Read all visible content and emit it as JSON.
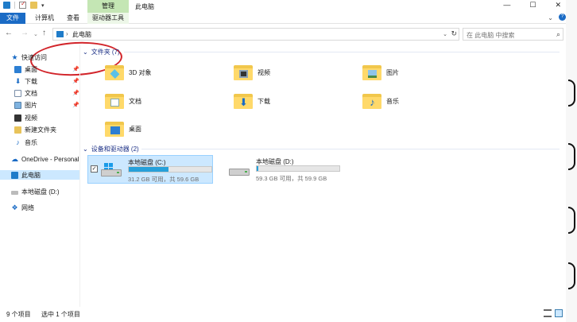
{
  "title_bar": {
    "manage_tab": "管理",
    "window_title": "此电脑",
    "controls": {
      "minimize": "—",
      "maximize": "☐",
      "close": "✕"
    }
  },
  "ribbon": {
    "tabs": [
      {
        "label": "文件",
        "active": true
      },
      {
        "label": "计算机"
      },
      {
        "label": "查看"
      },
      {
        "label": "驱动器工具"
      }
    ],
    "expand_glyph": "⌄",
    "help_glyph": "?"
  },
  "address": {
    "back": "←",
    "forward": "→",
    "recent": "⌄",
    "up": "↑",
    "separator": "›",
    "path": "此电脑",
    "dropdown": "⌄",
    "refresh": "↻",
    "search_placeholder": "在 此电脑 中搜索",
    "search_glyph": "⌕"
  },
  "sidebar": {
    "items": [
      {
        "label": "快速访问",
        "icon": "star-icon",
        "glyph": "★"
      },
      {
        "label": "桌面",
        "icon": "desktop-icon",
        "pinned": true
      },
      {
        "label": "下载",
        "icon": "download-icon",
        "glyph": "⬇",
        "pinned": true
      },
      {
        "label": "文档",
        "icon": "document-icon",
        "pinned": true
      },
      {
        "label": "图片",
        "icon": "picture-icon",
        "pinned": true
      },
      {
        "label": "视频",
        "icon": "video-icon"
      },
      {
        "label": "新建文件夹",
        "icon": "folder-icon"
      },
      {
        "label": "音乐",
        "icon": "music-icon",
        "glyph": "♪"
      },
      {
        "label": "OneDrive - Personal",
        "icon": "onedrive-icon",
        "glyph": "☁"
      },
      {
        "label": "此电脑",
        "icon": "this-pc-icon",
        "selected": true
      },
      {
        "label": "本地磁盘 (D:)",
        "icon": "drive-icon"
      },
      {
        "label": "网络",
        "icon": "network-icon",
        "glyph": "❖"
      }
    ],
    "pin_glyph": "📌"
  },
  "folders_group": {
    "header": "文件夹 (7)",
    "collapse_glyph": "⌄",
    "items": [
      {
        "label": "3D 对象",
        "badge": "3d"
      },
      {
        "label": "视频",
        "badge": "video"
      },
      {
        "label": "图片",
        "badge": "pic"
      },
      {
        "label": "文档",
        "badge": "doc"
      },
      {
        "label": "下载",
        "badge": "down",
        "glyph": "⬇"
      },
      {
        "label": "音乐",
        "badge": "music",
        "glyph": "♪"
      },
      {
        "label": "桌面",
        "badge": "desk"
      }
    ]
  },
  "drives_group": {
    "header": "设备和驱动器 (2)",
    "collapse_glyph": "⌄",
    "drives": [
      {
        "name": "本地磁盘 (C:)",
        "free_text": "31.2 GB 可用，共 59.6 GB",
        "used_fraction": 0.48,
        "selected": true,
        "checked": "✓"
      },
      {
        "name": "本地磁盘 (D:)",
        "free_text": "59.3 GB 可用，共 59.9 GB",
        "used_fraction": 0.01,
        "selected": false
      }
    ],
    "bar_color": "#26a0da"
  },
  "status": {
    "item_count": "9 个项目",
    "selection": "选中 1 个项目"
  },
  "colors": {
    "accent": "#1a6bc5",
    "manage_tab": "#c4e6b4",
    "selection": "#cce8ff",
    "annotation": "#d2242a"
  }
}
